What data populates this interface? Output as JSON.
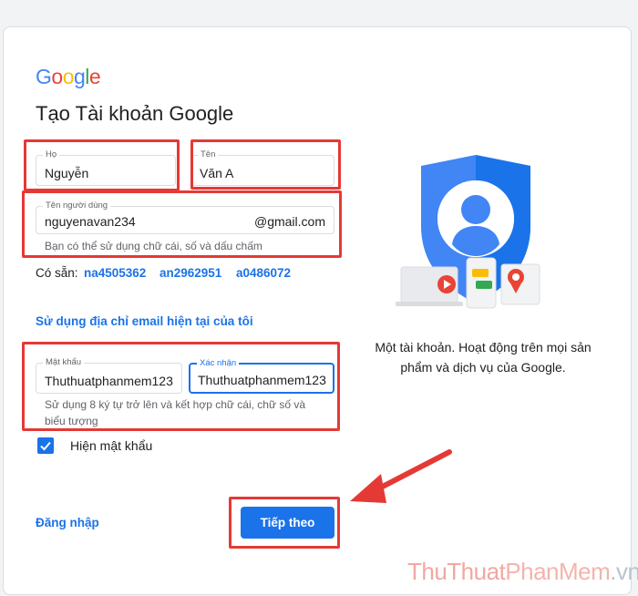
{
  "logo": {
    "letters": [
      "G",
      "o",
      "o",
      "g",
      "l",
      "e"
    ],
    "colors": [
      "#4285f4",
      "#ea4335",
      "#fbbc05",
      "#4285f4",
      "#34a853",
      "#ea4335"
    ]
  },
  "title": "Tạo Tài khoản Google",
  "fields": {
    "last_name": {
      "label": "Họ",
      "value": "Nguyễn"
    },
    "first_name": {
      "label": "Tên",
      "value": "Văn A"
    },
    "username": {
      "label": "Tên người dùng",
      "value": "nguyenavan234",
      "suffix": "@gmail.com",
      "hint": "Bạn có thể sử dụng chữ cái, số và dấu chấm"
    },
    "password": {
      "label": "Mật khẩu",
      "value": "Thuthuatphanmem123"
    },
    "confirm": {
      "label": "Xác nhận",
      "value": "Thuthuatphanmem123"
    },
    "password_hint": "Sử dụng 8 ký tự trở lên và kết hợp chữ cái, chữ số và biểu tượng"
  },
  "availability": {
    "label": "Có sẵn:",
    "options": [
      "na4505362",
      "an2962951",
      "a0486072"
    ]
  },
  "use_current_email": "Sử dụng địa chỉ email hiện tại của tôi",
  "show_password": {
    "label": "Hiện mật khẩu",
    "checked": true
  },
  "sign_in": "Đăng nhập",
  "next": "Tiếp theo",
  "caption": "Một tài khoản. Hoạt động trên mọi sản phẩm và dịch vụ của Google.",
  "watermark": {
    "part1": "ThuThuat",
    "part2": "PhanMem",
    "part3": ".vn"
  },
  "colors": {
    "accent": "#1a73e8",
    "highlight": "#e53935"
  }
}
